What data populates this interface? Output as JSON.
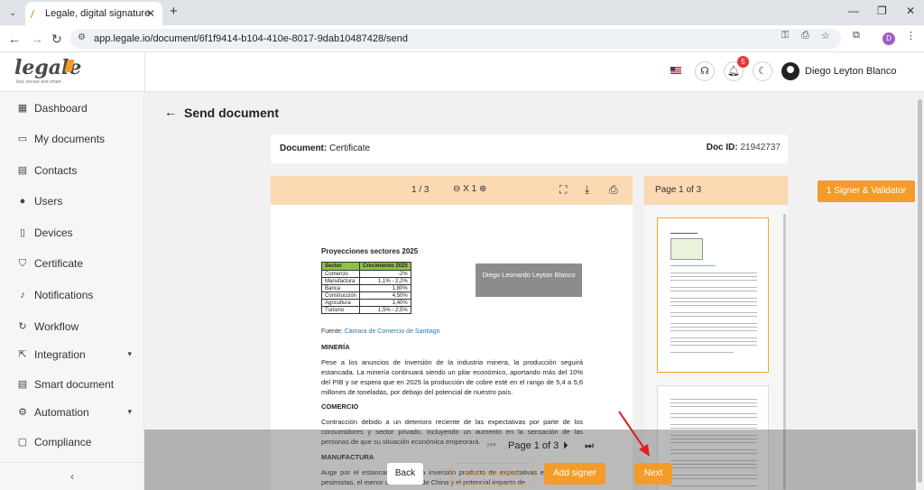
{
  "browser": {
    "tab_title": "Legale, digital signature",
    "url": "app.legale.io/document/6f1f9414-b104-410e-8017-9dab10487428/send",
    "profile_initial": "D"
  },
  "header": {
    "logo": "legale",
    "logo_tagline": "fast, secure and smart",
    "notification_count": "5",
    "user_name": "Diego Leyton Blanco"
  },
  "sidebar": {
    "items": [
      {
        "label": "Dashboard",
        "icon": "dashboard-icon"
      },
      {
        "label": "My documents",
        "icon": "folder-icon"
      },
      {
        "label": "Contacts",
        "icon": "contacts-icon"
      },
      {
        "label": "Users",
        "icon": "user-icon"
      },
      {
        "label": "Devices",
        "icon": "device-icon"
      },
      {
        "label": "Certificate",
        "icon": "shield-icon"
      },
      {
        "label": "Notifications",
        "icon": "bell-icon"
      },
      {
        "label": "Workflow",
        "icon": "workflow-icon"
      },
      {
        "label": "Integration",
        "icon": "integration-icon"
      },
      {
        "label": "Smart document",
        "icon": "smart-document-icon"
      },
      {
        "label": "Automation",
        "icon": "gear-icon"
      },
      {
        "label": "Compliance",
        "icon": "compliance-icon"
      }
    ],
    "collapse": "‹"
  },
  "main": {
    "title": "Send document",
    "document_label": "Document:",
    "document_name": "Certificate",
    "doc_id_label": "Doc ID:",
    "doc_id": "21942737"
  },
  "viewer": {
    "page_indicator": "1 / 3",
    "zoom": "X 1",
    "thumbs_label": "Page 1 of 3"
  },
  "document": {
    "heading": "Proyecciones sectores 2025",
    "table_headers": [
      "Sector",
      "Crecimiento 2025"
    ],
    "table_rows": [
      [
        "Comercio",
        "-2%"
      ],
      [
        "Manufactura",
        "1,1% - 2,2%"
      ],
      [
        "Banca",
        "1,80%"
      ],
      [
        "Construcción",
        "4,50%"
      ],
      [
        "Agricultura",
        "1,40%"
      ],
      [
        "Turismo",
        "1,5% - 2,5%"
      ]
    ],
    "source_label": "Fuente:",
    "source_name": "Cámara de Comercio de Santiago",
    "signature_name": "Diego Leonardo Leyton Blanco",
    "mineria_title": "MINERÍA",
    "mineria_text": "Pese a los anuncios de inversión de la industria minera, la producción seguirá estancada. La minería continuará siendo un pilar económico, aportando más del 10% del PIB y se espera que en 2025 la producción de cobre esté en el rango de 5,4 a 5,6 millones de toneladas, por debajo del potencial de nuestro país.",
    "comercio_title": "COMERCIO",
    "comercio_text": "Contracción debido a un deterioro reciente de las expectativas por parte de los consumidores y sector privado, incluyendo un aumento en la sensación de las personas de que su situación económica empeorará.",
    "manufactura_title": "MANUFACTURA",
    "manufactura_text": "Auge por el estancamiento de la inversión producto de expectativas empresariales pesimistas, el menor crecimiento de China y el potencial impacto de"
  },
  "actions": {
    "signer_validator": "1 Signer & Validator",
    "pager_label": "Page 1 of 3",
    "back": "Back",
    "select_workflow": "Select workflow",
    "add_signer": "Add signer",
    "next": "Next"
  },
  "colors": {
    "accent": "#f39c2a",
    "toolbar_bg": "#fbd9b2",
    "table_header": "#8dc33b"
  }
}
